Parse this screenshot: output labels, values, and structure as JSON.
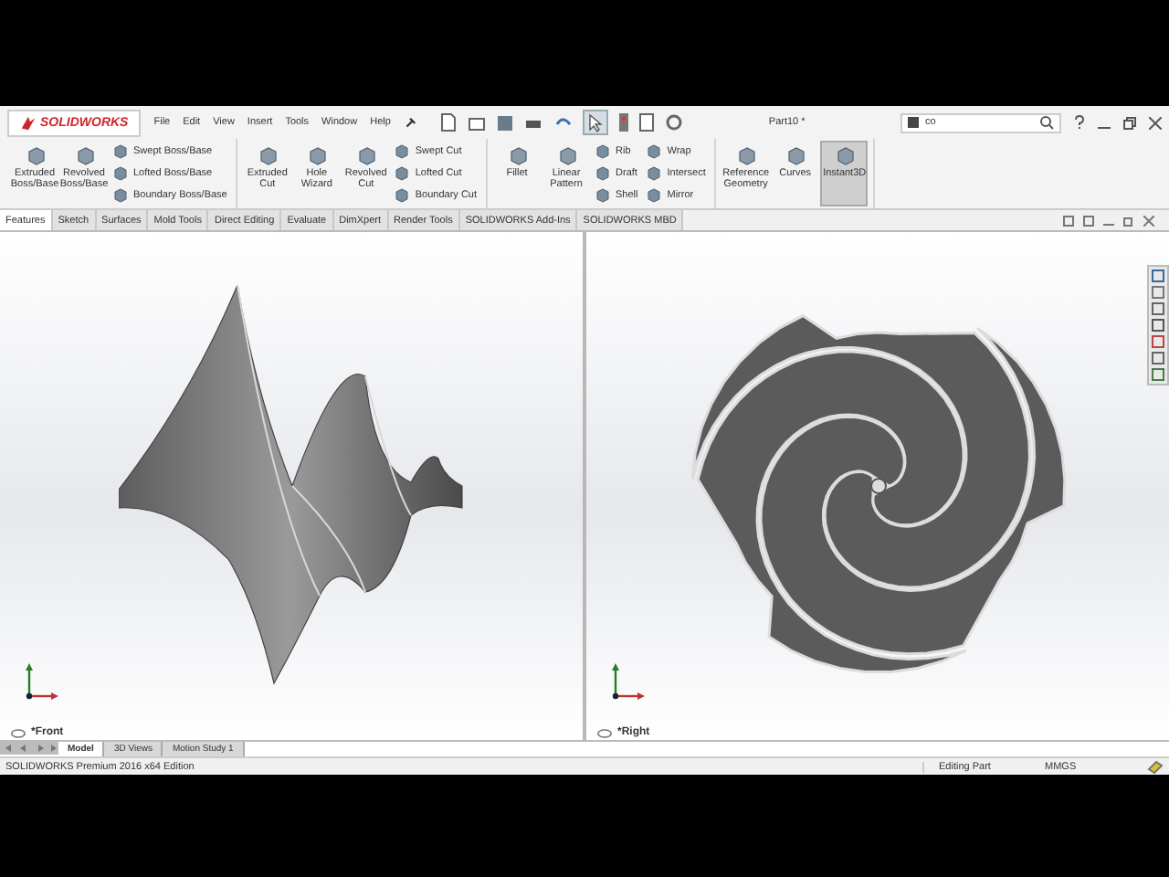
{
  "logo": "SOLIDWORKS",
  "menu": [
    "File",
    "Edit",
    "View",
    "Insert",
    "Tools",
    "Window",
    "Help"
  ],
  "document_title": "Part10 *",
  "search": {
    "value": "co"
  },
  "ribbon": [
    {
      "columns": [
        {
          "kind": "large",
          "items": [
            {
              "label": "Extruded Boss/Base",
              "on": false
            }
          ]
        },
        {
          "kind": "large",
          "items": [
            {
              "label": "Revolved Boss/Base",
              "on": false
            }
          ]
        },
        {
          "kind": "stack",
          "items": [
            {
              "label": "Swept Boss/Base",
              "on": false
            },
            {
              "label": "Lofted Boss/Base",
              "on": false
            },
            {
              "label": "Boundary Boss/Base",
              "on": false
            }
          ]
        }
      ]
    },
    {
      "columns": [
        {
          "kind": "large",
          "items": [
            {
              "label": "Extruded Cut",
              "on": false
            }
          ]
        },
        {
          "kind": "large",
          "items": [
            {
              "label": "Hole Wizard",
              "on": false
            }
          ]
        },
        {
          "kind": "large",
          "items": [
            {
              "label": "Revolved Cut",
              "on": false
            }
          ]
        },
        {
          "kind": "stack",
          "items": [
            {
              "label": "Swept Cut",
              "on": false
            },
            {
              "label": "Lofted Cut",
              "on": false
            },
            {
              "label": "Boundary Cut",
              "on": false
            }
          ]
        }
      ]
    },
    {
      "columns": [
        {
          "kind": "large",
          "items": [
            {
              "label": "Fillet",
              "on": false
            }
          ]
        },
        {
          "kind": "large",
          "items": [
            {
              "label": "Linear Pattern",
              "on": false
            }
          ]
        },
        {
          "kind": "stack",
          "items": [
            {
              "label": "Rib",
              "on": false
            },
            {
              "label": "Draft",
              "on": false
            },
            {
              "label": "Shell",
              "on": false
            }
          ]
        },
        {
          "kind": "stack",
          "items": [
            {
              "label": "Wrap",
              "on": false
            },
            {
              "label": "Intersect",
              "on": false
            },
            {
              "label": "Mirror",
              "on": false
            }
          ]
        }
      ]
    },
    {
      "columns": [
        {
          "kind": "large",
          "items": [
            {
              "label": "Reference Geometry",
              "on": false
            }
          ]
        },
        {
          "kind": "large",
          "items": [
            {
              "label": "Curves",
              "on": false
            }
          ]
        },
        {
          "kind": "large",
          "items": [
            {
              "label": "Instant3D",
              "on": true
            }
          ]
        }
      ]
    }
  ],
  "tabs": [
    {
      "label": "Features",
      "selected": true
    },
    {
      "label": "Sketch",
      "selected": false
    },
    {
      "label": "Surfaces",
      "selected": false
    },
    {
      "label": "Mold Tools",
      "selected": false
    },
    {
      "label": "Direct Editing",
      "selected": false
    },
    {
      "label": "Evaluate",
      "selected": false
    },
    {
      "label": "DimXpert",
      "selected": false
    },
    {
      "label": "Render Tools",
      "selected": false
    },
    {
      "label": "SOLIDWORKS Add-Ins",
      "selected": false
    },
    {
      "label": "SOLIDWORKS MBD",
      "selected": false
    }
  ],
  "viewports": [
    {
      "kind": "front",
      "label": "*Front"
    },
    {
      "kind": "right",
      "label": "*Right"
    }
  ],
  "bottom_tabs": [
    {
      "label": "Model",
      "selected": true
    },
    {
      "label": "3D Views",
      "selected": false
    },
    {
      "label": "Motion Study 1",
      "selected": false
    }
  ],
  "status_bar": {
    "edition": "SOLIDWORKS Premium 2016 x64 Edition",
    "mode": "Editing Part",
    "units": "MMGS"
  }
}
